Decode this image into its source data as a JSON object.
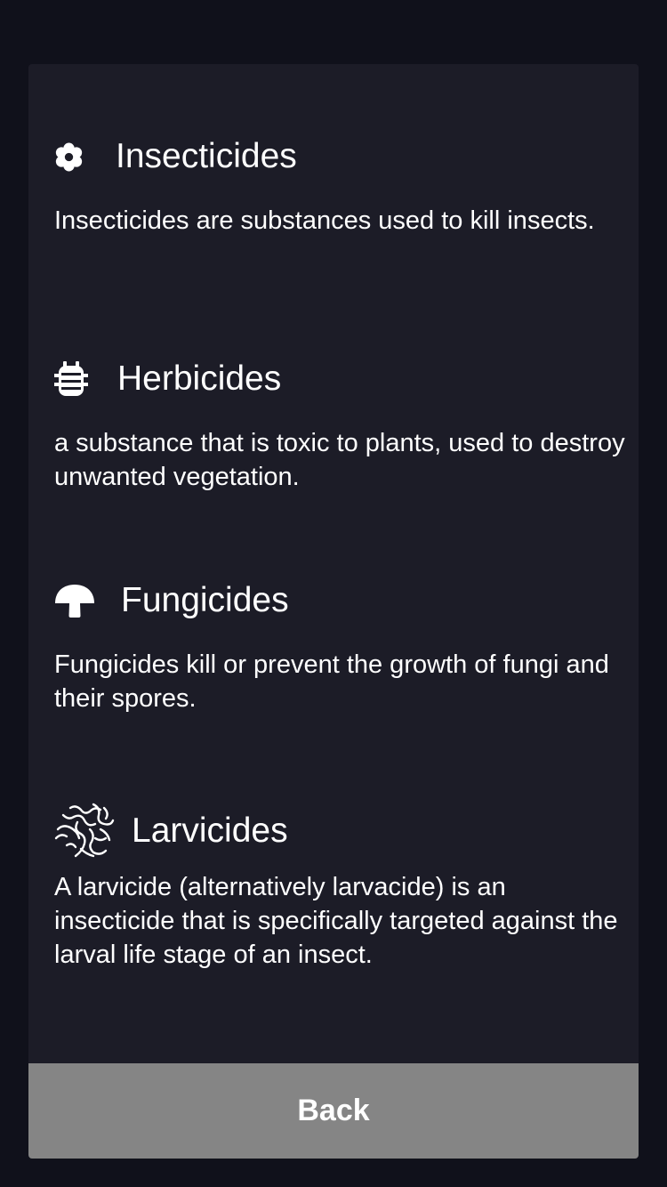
{
  "sections": [
    {
      "icon": "flower-icon",
      "title": "Insecticides",
      "description": "Insecticides are substances used to kill insects."
    },
    {
      "icon": "bug-icon",
      "title": "Herbicides",
      "description": "a substance that is toxic to plants, used to destroy unwanted vegetation."
    },
    {
      "icon": "mushroom-icon",
      "title": "Fungicides",
      "description": "Fungicides kill or prevent the growth of fungi and their spores."
    },
    {
      "icon": "larvae-icon",
      "title": "Larvicides",
      "description": "A larvicide (alternatively larvacide) is an insecticide that is specifically targeted against the larval life stage of an insect."
    }
  ],
  "back_button": {
    "label": "Back",
    "background": "#858585"
  },
  "colors": {
    "page_background": "#10111b",
    "card_background": "#1c1c27",
    "text": "#ffffff"
  }
}
